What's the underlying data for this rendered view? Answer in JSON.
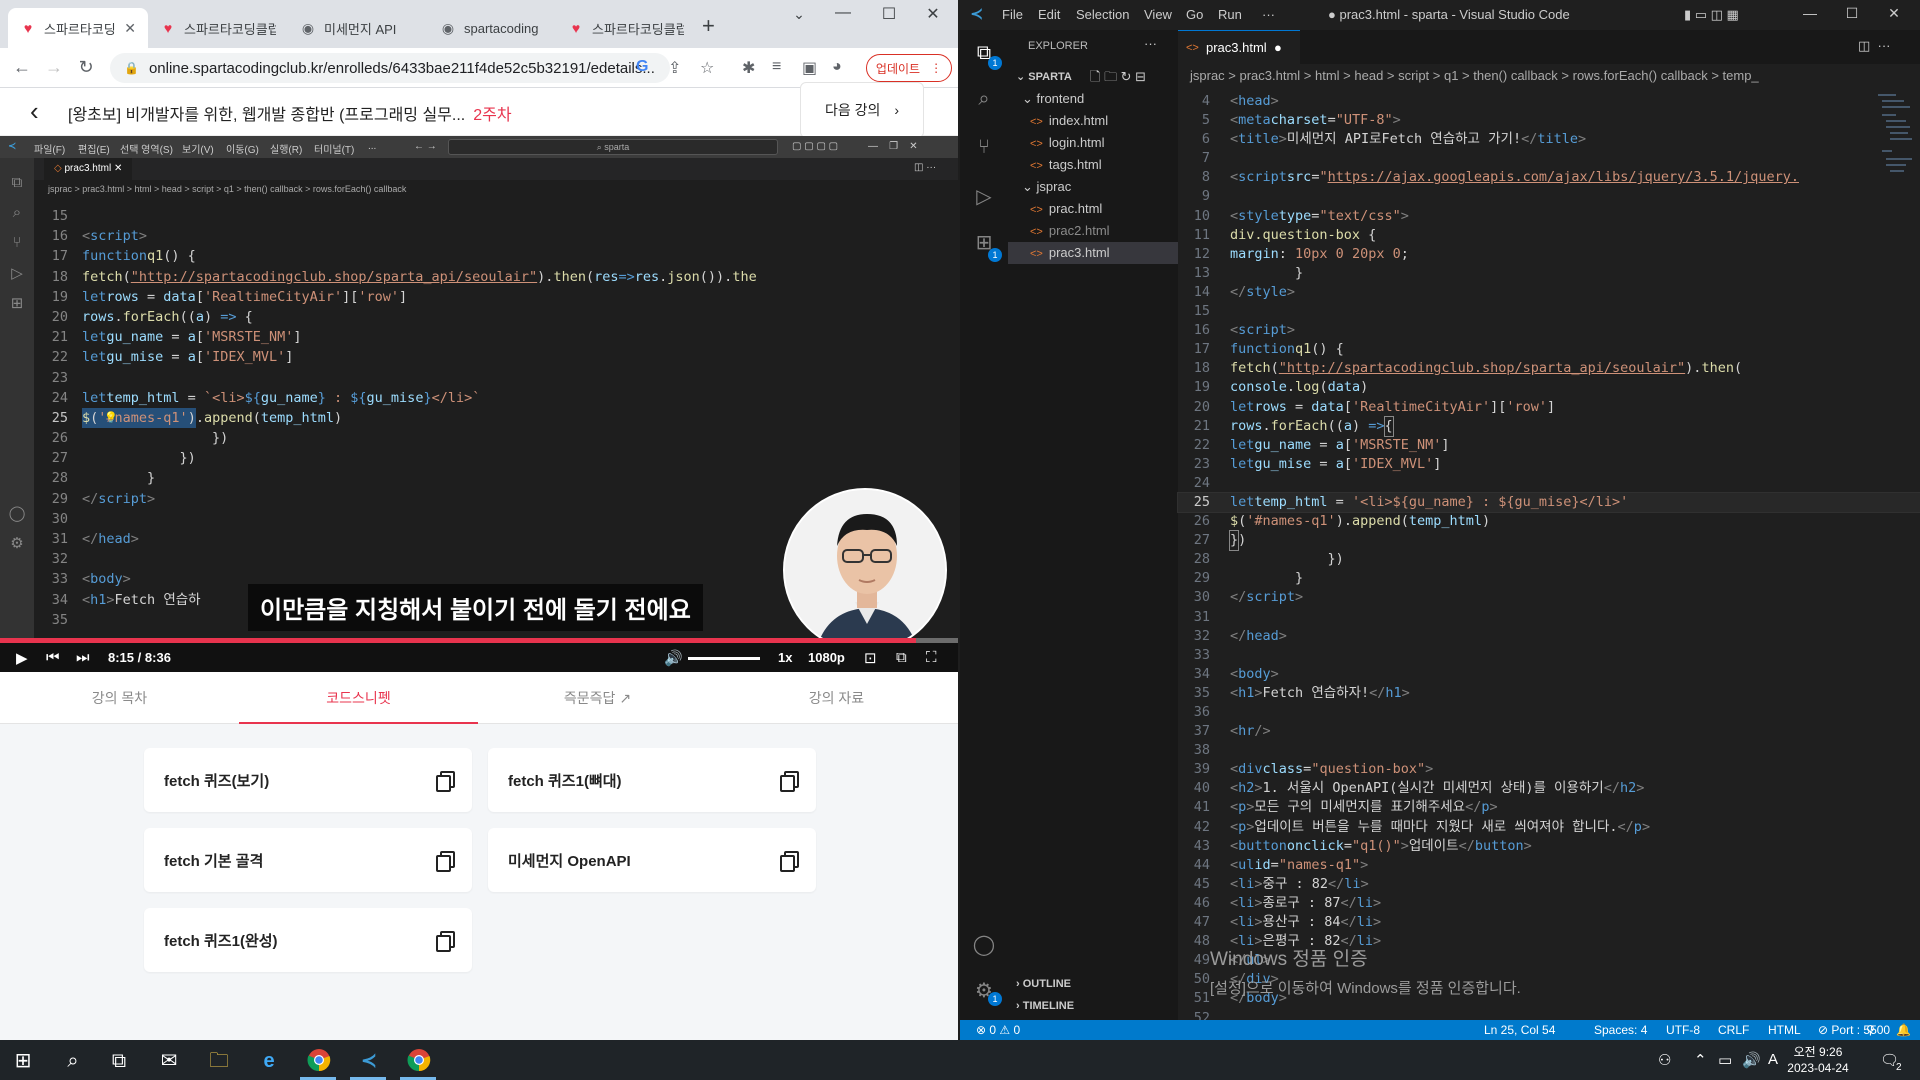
{
  "browser": {
    "tabs": [
      {
        "title": "스파르타코딩클럽",
        "icon": "heart-icon"
      },
      {
        "title": "스파르타코딩클럽",
        "icon": "heart-icon"
      },
      {
        "title": "미세먼지 API",
        "icon": "globe-icon"
      },
      {
        "title": "spartacoding",
        "icon": "globe-icon"
      },
      {
        "title": "스파르타코딩클럽",
        "icon": "heart-icon"
      }
    ],
    "url": "online.spartacodingclub.kr/enrolleds/6433bae211f4de52c5b32191/edetails...",
    "update_label": "업데이트"
  },
  "lecture": {
    "title": "[왕초보] 비개발자를 위한, 웹개발 종합반 (프로그래밍 실무...",
    "week": "2주차",
    "next_label": "다음 강의"
  },
  "video": {
    "subtitle": "이만큼을 지칭해서 붙이기 전에 돌기 전에요",
    "current_time": "8:15",
    "separator": "/",
    "duration": "8:36",
    "progress": 0.956,
    "speed": "1x",
    "quality": "1080p",
    "inner_menu": [
      "파일(F)",
      "편집(E)",
      "선택 영역(S)",
      "보기(V)",
      "이동(G)",
      "실행(R)",
      "터미널(T)",
      "..."
    ],
    "inner_search": "sparta",
    "inner_tab": "prac3.html",
    "inner_breadcrumb": "jsprac > prac3.html > html > head > script > q1 > then() callback > rows.forEach() callback"
  },
  "subtabs": [
    "강의 목차",
    "코드스니펫",
    "즉문즉답",
    "강의 자료"
  ],
  "snippets": [
    "fetch 퀴즈(보기)",
    "fetch 퀴즈1(뼈대)",
    "fetch 기본 골격",
    "미세먼지 OpenAPI",
    "fetch 퀴즈1(완성)"
  ],
  "vscode": {
    "menu": [
      "File",
      "Edit",
      "Selection",
      "View",
      "Go",
      "Run",
      "···"
    ],
    "window_title": "● prac3.html - sparta - Visual Studio Code",
    "explorer_label": "EXPLORER",
    "project": "SPARTA",
    "tree": [
      {
        "name": "frontend",
        "type": "folder"
      },
      {
        "name": "index.html",
        "type": "file"
      },
      {
        "name": "login.html",
        "type": "file"
      },
      {
        "name": "tags.html",
        "type": "file"
      },
      {
        "name": "jsprac",
        "type": "folder"
      },
      {
        "name": "prac.html",
        "type": "file"
      },
      {
        "name": "prac2.html",
        "type": "file"
      },
      {
        "name": "prac3.html",
        "type": "file"
      }
    ],
    "outline_label": "OUTLINE",
    "timeline_label": "TIMELINE",
    "tab": "prac3.html",
    "breadcrumb": "jsprac > prac3.html > html > head > script > q1 > then() callback > rows.forEach() callback > temp_",
    "status": {
      "errors": "⊗ 0 ⚠ 0",
      "position": "Ln 25, Col 54",
      "spaces": "Spaces: 4",
      "encoding": "UTF-8",
      "eol": "CRLF",
      "language": "HTML",
      "port": "⊘ Port : 5500"
    },
    "watermark_title": "Windows 정품 인증",
    "watermark_text": "[설정]으로 이동하여 Windows를 정품 인증합니다."
  },
  "taskbar": {
    "time": "오전 9:26",
    "date": "2023-04-24",
    "ime": "A",
    "notifications": "2"
  },
  "colors": {
    "accent": "#e8344e",
    "vscode_status": "#007acc"
  }
}
